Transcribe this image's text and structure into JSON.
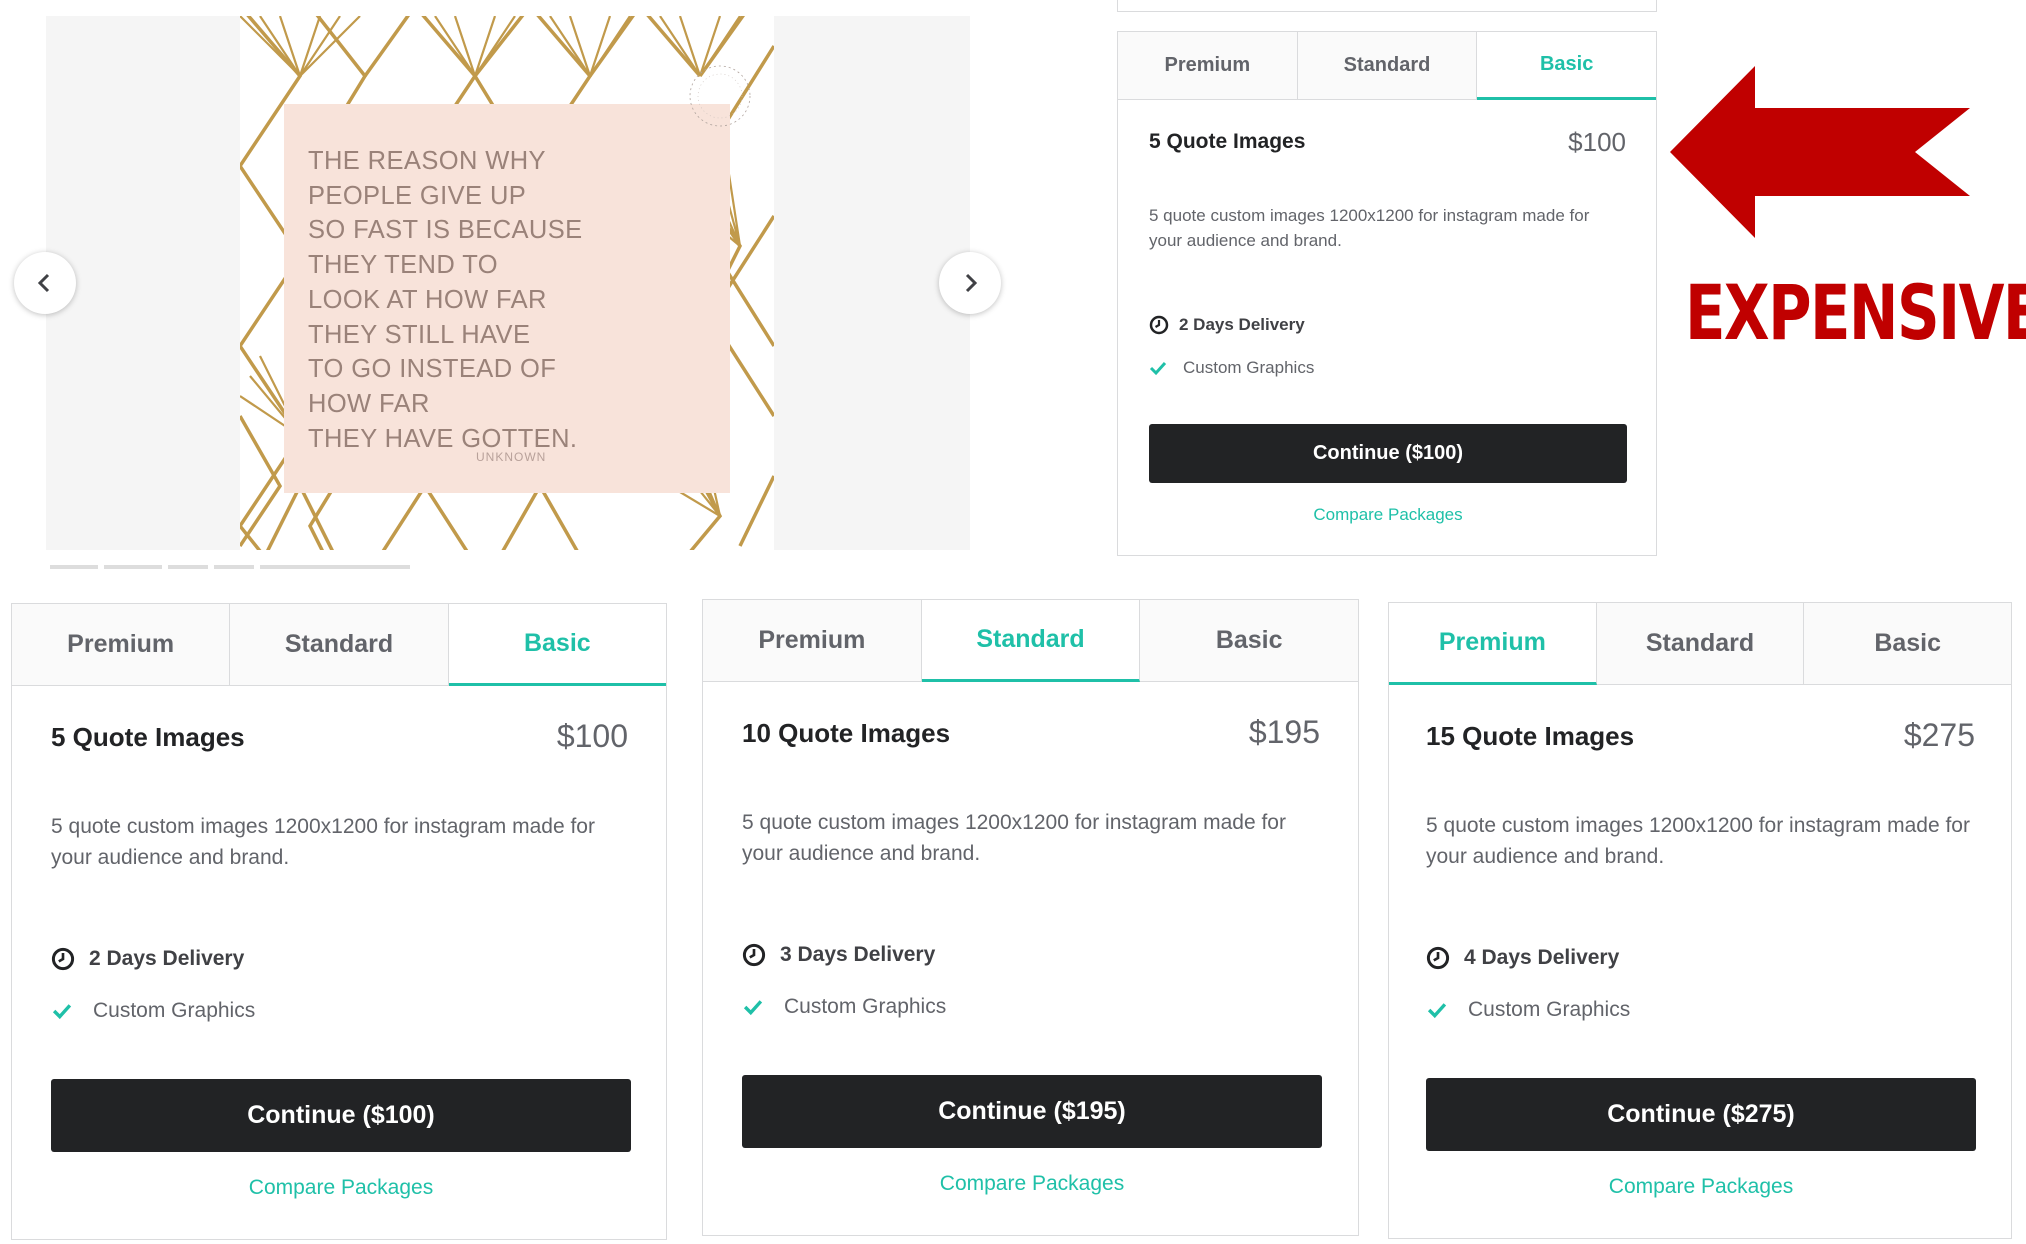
{
  "quote": {
    "lines": [
      "The reason why",
      "people give up",
      "so fast is because",
      "they tend to",
      "look at how far",
      "they still have",
      "to go instead of",
      "how far",
      "they have gotten."
    ],
    "author": "UNKNOWN"
  },
  "colors": {
    "accent": "#1fc0a8",
    "button": "#222325",
    "annotation": "#c00000"
  },
  "annotation": {
    "label": "EXPENSIVE"
  },
  "tab_labels": [
    "Premium",
    "Standard",
    "Basic"
  ],
  "top_card": {
    "active_tab": "Basic",
    "title": "5 Quote Images",
    "price": "$100",
    "description": "5 quote custom images 1200x1200 for instagram made for your audience and brand.",
    "delivery": "2 Days Delivery",
    "feature": "Custom Graphics",
    "continue_label": "Continue ($100)",
    "compare_label": "Compare Packages"
  },
  "cards": [
    {
      "active_tab": "Basic",
      "title": "5 Quote Images",
      "price": "$100",
      "description": "5 quote custom images 1200x1200 for instagram made for your audience and brand.",
      "delivery": "2 Days Delivery",
      "feature": "Custom Graphics",
      "continue_label": "Continue ($100)",
      "compare_label": "Compare Packages"
    },
    {
      "active_tab": "Standard",
      "title": "10 Quote Images",
      "price": "$195",
      "description": "5 quote custom images 1200x1200 for instagram made for your audience and brand.",
      "delivery": "3 Days Delivery",
      "feature": "Custom Graphics",
      "continue_label": "Continue ($195)",
      "compare_label": "Compare Packages"
    },
    {
      "active_tab": "Premium",
      "title": "15 Quote Images",
      "price": "$275",
      "description": "5 quote custom images 1200x1200 for instagram made for your audience and brand.",
      "delivery": "4 Days Delivery",
      "feature": "Custom Graphics",
      "continue_label": "Continue ($275)",
      "compare_label": "Compare Packages"
    }
  ]
}
